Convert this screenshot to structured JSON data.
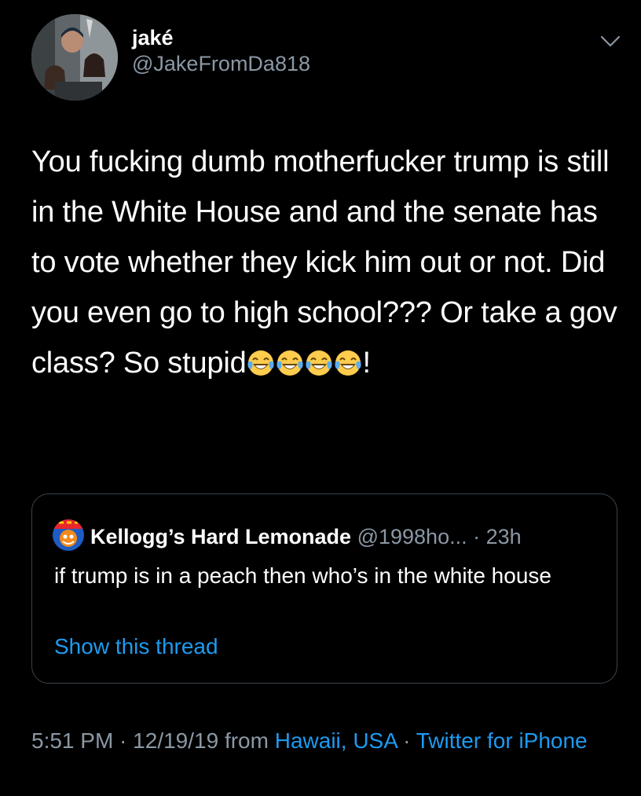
{
  "author": {
    "display_name": "jaké",
    "handle": "@JakeFromDa818"
  },
  "tweet": {
    "text_main": "You fucking dumb motherfucker trump is still in the White House and and the senate has to vote whether they kick him out or not. Did you even go to high school??? Or take a gov class? So stupid",
    "emoji_name": "face-with-tears-of-joy",
    "emoji_count": 4,
    "text_end": "!"
  },
  "quote": {
    "name": "Kellogg’s Hard Lemonade",
    "handle": "@1998ho...",
    "separator": " · ",
    "time": "23h",
    "text": "if trump is in a peach then who’s in the white house",
    "thread_link": "Show this thread"
  },
  "meta": {
    "time": "5:51 PM",
    "date": "12/19/19",
    "from_word": "from",
    "location": "Hawaii, USA",
    "source": "Twitter for iPhone",
    "separator": " · "
  },
  "colors": {
    "background": "#000000",
    "text": "#ffffff",
    "secondary": "#8b98a5",
    "link": "#1d9bf0",
    "border": "#38444d"
  }
}
